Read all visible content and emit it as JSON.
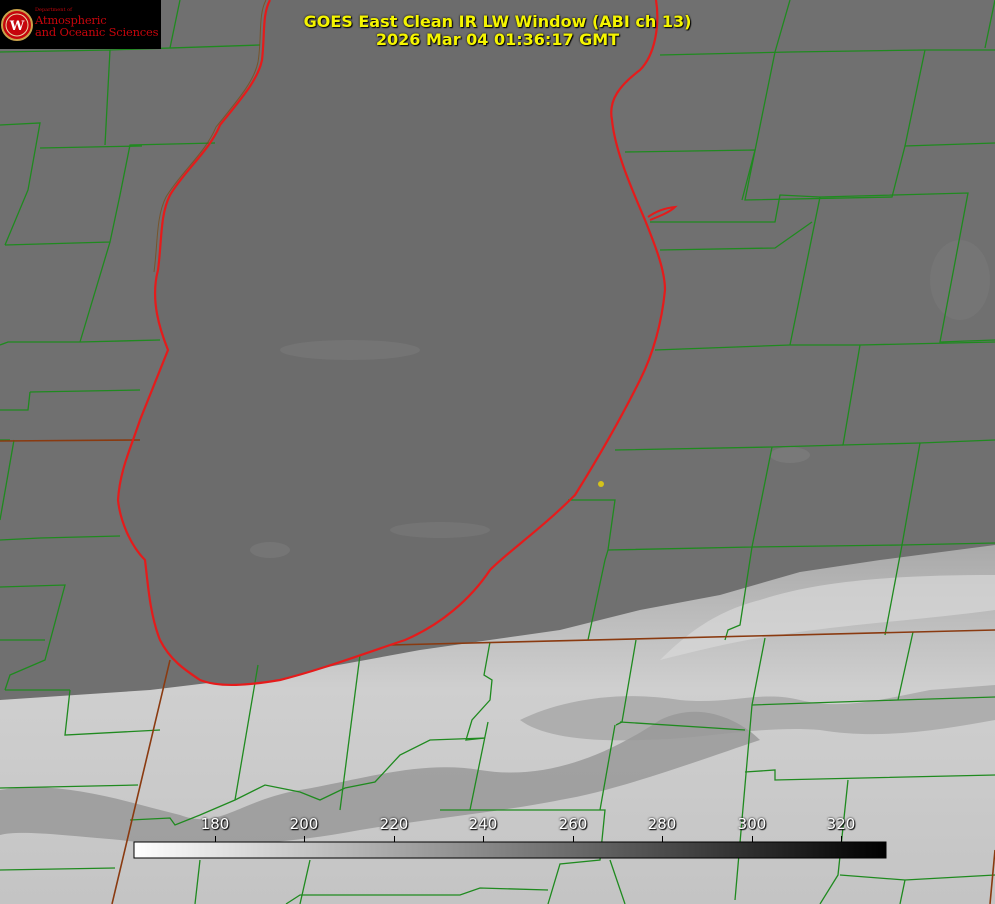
{
  "title": {
    "line1": "GOES East Clean IR LW Window (ABI ch 13)",
    "line2": "2026 Mar 04 01:36:17 GMT"
  },
  "logo": {
    "department": "Department of",
    "line1": "Atmospheric",
    "line2": "and Oceanic Sciences",
    "emblem_letter": "W"
  },
  "colorbar": {
    "ticks": [
      "180",
      "200",
      "220",
      "240",
      "260",
      "280",
      "300",
      "320"
    ],
    "start_color": "#ffffff",
    "end_color": "#000000"
  },
  "colors": {
    "county_lines": "#1f8a1f",
    "lake_shore": "#e51b1b",
    "state_border": "#8a3a10",
    "title_text": "#f5f500",
    "logo_red": "#c5050c",
    "marker": "#d4c21a"
  }
}
